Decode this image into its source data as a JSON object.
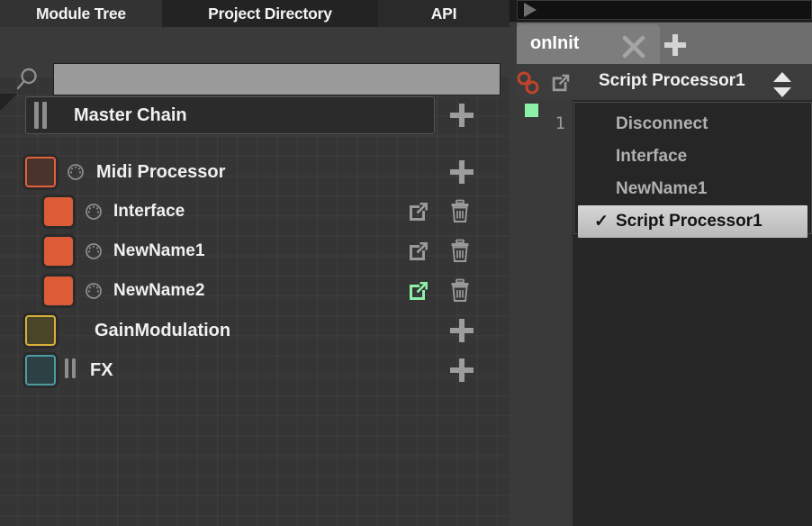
{
  "left_panel": {
    "tabs": [
      {
        "label": "Module Tree",
        "active": true
      },
      {
        "label": "Project Directory",
        "active": false
      },
      {
        "label": "API",
        "active": false
      }
    ],
    "search": {
      "value": "",
      "placeholder": "",
      "icon": "search-icon"
    },
    "tree": {
      "master": {
        "label": "Master Chain",
        "add_icon": "plus-icon"
      },
      "nodes": [
        {
          "label": "Midi Processor",
          "level": 1,
          "swatch_color": "#e2603c",
          "knob_icon": "knob-icon",
          "actions": [
            "plus-icon"
          ]
        },
        {
          "label": "Interface",
          "level": 2,
          "swatch_color": "#dd5c38",
          "knob_icon": "knob-icon",
          "actions": [
            "popout-icon",
            "trash-icon"
          ],
          "popout_active": false
        },
        {
          "label": "NewName1",
          "level": 2,
          "swatch_color": "#dd5c38",
          "knob_icon": "knob-icon",
          "actions": [
            "popout-icon",
            "trash-icon"
          ],
          "popout_active": false
        },
        {
          "label": "NewName2",
          "level": 2,
          "swatch_color": "#dd5c38",
          "knob_icon": "knob-icon",
          "actions": [
            "popout-icon",
            "trash-icon"
          ],
          "popout_active": true
        },
        {
          "label": "GainModulation",
          "level": 1,
          "swatch_color": "#d9b13a",
          "actions": [
            "plus-icon"
          ]
        },
        {
          "label": "FX",
          "level": 1,
          "swatch_color": "#4f9ca0",
          "actions": [
            "plus-icon"
          ]
        }
      ]
    }
  },
  "right_panel": {
    "transport": {
      "play_icon": "play-icon"
    },
    "script_tab": {
      "label": "onInit",
      "close_icon": "close-icon",
      "add_icon": "plus-icon"
    },
    "processor_bar": {
      "link_icon": "chain-link-icon",
      "popout_icon": "popout-icon",
      "name": "Script Processor1",
      "stepper_icon": "up-down-arrows-icon"
    },
    "editor": {
      "line_number": "1",
      "breakpoint_indicator": "green-square-icon",
      "content": ""
    }
  },
  "dropdown": {
    "items": [
      {
        "label": "Disconnect",
        "checked": false
      },
      {
        "label": "Interface",
        "checked": false
      },
      {
        "label": "NewName1",
        "checked": false
      },
      {
        "label": "Script Processor1",
        "checked": true
      }
    ],
    "check_glyph": "✓"
  },
  "colors": {
    "accent_orange": "#dd5c38",
    "accent_green": "#8cf0a8",
    "accent_yellow": "#d9b13a",
    "accent_teal": "#4f9ca0",
    "link_red": "#c0442a"
  }
}
